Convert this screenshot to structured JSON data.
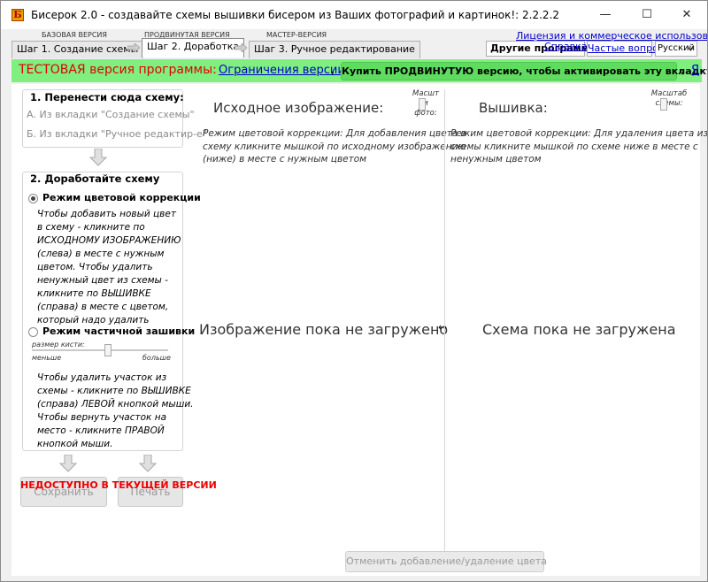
{
  "window": {
    "title": "Бисерок 2.0 - создавайте схемы вышивки бисером из Ваших фотографий и картинок!: 2.2.2.2",
    "app_icon_letter": "Б",
    "minimize": "—",
    "maximize": "☐",
    "close": "✕"
  },
  "top_links": {
    "license": "Лицензия и коммерческое использование",
    "other_programs": "Другие программы",
    "help": "Справка",
    "faq": "Частые вопросы",
    "language": "Русский"
  },
  "version_captions": {
    "basic": "БАЗОВАЯ ВЕРСИЯ",
    "advanced": "ПРОДВИНУТАЯ ВЕРСИЯ",
    "master": "МАСТЕР-ВЕРСИЯ"
  },
  "tabs": [
    {
      "label": "Шаг 1. Создание схемы"
    },
    {
      "label": "Шаг 2. Доработка"
    },
    {
      "label": "Шаг 3. Ручное редактирование"
    }
  ],
  "banner": {
    "test_version": "ТЕСТОВАЯ версия программы:",
    "limitations_link": "Ограничения версии",
    "comma1": ",",
    "buy_button": "Купить ПРОДВИНУТУЮ версию, чтобы активировать эту вкладку",
    "comma2": ",",
    "trail": "Я"
  },
  "left": {
    "section1_title": "1. Перенести сюда схему:",
    "from_tab_create": "А. Из вкладки \"Создание схемы\"",
    "from_tab_manual": "Б. Из вкладки \"Ручное редактир-е\"",
    "section2_title": "2. Доработайте схему",
    "mode_color_label": "Режим цветовой коррекции",
    "mode_color_desc": [
      "Чтобы добавить новый цвет",
      "в схему - кликните по",
      "ИСХОДНОМУ ИЗОБРАЖЕНИЮ",
      "(слева) в месте с нужным",
      "цветом. Чтобы удалить",
      "ненужный цвет из схемы -",
      "кликните по ВЫШИВКЕ",
      "(справа) в месте с цветом,",
      "который надо удалить"
    ],
    "mode_partial_label": "Режим частичной зашивки",
    "brush_size": "размер кисти:",
    "brush_less": "меньше",
    "brush_more": "больше",
    "partial_desc": [
      "Чтобы удалить участок из",
      "схемы - кликните по ВЫШИВКЕ",
      "(справа) ЛЕВОЙ кнопкой мыши.",
      "Чтобы вернуть участок на",
      "место - кликните ПРАВОЙ",
      "кнопкой мыши."
    ],
    "unavailable": "НЕДОСТУПНО В ТЕКУЩЕЙ ВЕРСИИ",
    "save_button": "Сохранить",
    "print_button": "Печать"
  },
  "source_panel": {
    "title": "Исходное изображение:",
    "zoom_label": [
      "Масшт",
      "и",
      "фото:"
    ],
    "hint": [
      "Режим цветовой коррекции: Для добавления цвета в",
      "схему кликните мышкой по исходному изображению",
      "(ниже) в месте с нужным цветом"
    ],
    "placeholder": "Изображение пока не загружено",
    "swap_icon_text": "↔"
  },
  "scheme_panel": {
    "title": "Вышивка:",
    "zoom_label": [
      "Масштаб",
      "схемы:"
    ],
    "hint": [
      "Режим цветовой коррекции: Для удаления цвета из",
      "схемы кликните мышкой по схеме ниже в месте с",
      "ненужным цветом"
    ],
    "placeholder": "Схема пока не загружена"
  },
  "undo_button": "Отменить добавление/удаление цвета",
  "colors": {
    "banner_bg": "#7ff07f",
    "buy_button_bg": "#66e266",
    "test_red": "#e00000",
    "unavailable_red": "#ee0000",
    "link_blue": "#0000cc"
  }
}
